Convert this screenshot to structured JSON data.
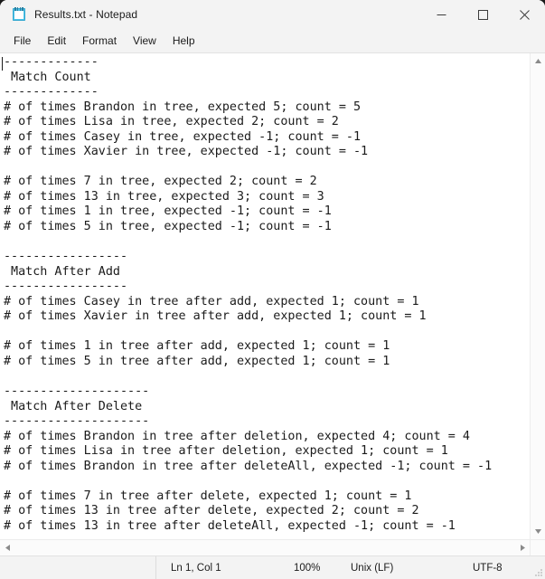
{
  "window": {
    "title": "Results.txt - Notepad",
    "icon": "notepad-icon",
    "controls": {
      "minimize": "minimize-icon",
      "maximize": "maximize-icon",
      "close": "close-icon"
    }
  },
  "menu": {
    "items": [
      {
        "label": "File"
      },
      {
        "label": "Edit"
      },
      {
        "label": "Format"
      },
      {
        "label": "View"
      },
      {
        "label": "Help"
      }
    ]
  },
  "document": {
    "filename": "Results.txt",
    "content": "-------------\n Match Count\n-------------\n# of times Brandon in tree, expected 5; count = 5\n# of times Lisa in tree, expected 2; count = 2\n# of times Casey in tree, expected -1; count = -1\n# of times Xavier in tree, expected -1; count = -1\n\n# of times 7 in tree, expected 2; count = 2\n# of times 13 in tree, expected 3; count = 3\n# of times 1 in tree, expected -1; count = -1\n# of times 5 in tree, expected -1; count = -1\n\n-----------------\n Match After Add\n-----------------\n# of times Casey in tree after add, expected 1; count = 1\n# of times Xavier in tree after add, expected 1; count = 1\n\n# of times 1 in tree after add, expected 1; count = 1\n# of times 5 in tree after add, expected 1; count = 1\n\n--------------------\n Match After Delete\n--------------------\n# of times Brandon in tree after deletion, expected 4; count = 4\n# of times Lisa in tree after deletion, expected 1; count = 1\n# of times Brandon in tree after deleteAll, expected -1; count = -1\n\n# of times 7 in tree after delete, expected 1; count = 1\n# of times 13 in tree after delete, expected 2; count = 2\n# of times 13 in tree after deleteAll, expected -1; count = -1\n"
  },
  "scrollbars": {
    "vertical": {
      "up_arrow": "scroll-up-icon",
      "down_arrow": "scroll-down-icon"
    },
    "horizontal": {
      "left_arrow": "scroll-left-icon",
      "right_arrow": "scroll-right-icon"
    }
  },
  "statusbar": {
    "position": "Ln 1, Col 1",
    "zoom": "100%",
    "line_ending": "Unix (LF)",
    "encoding": "UTF-8"
  }
}
